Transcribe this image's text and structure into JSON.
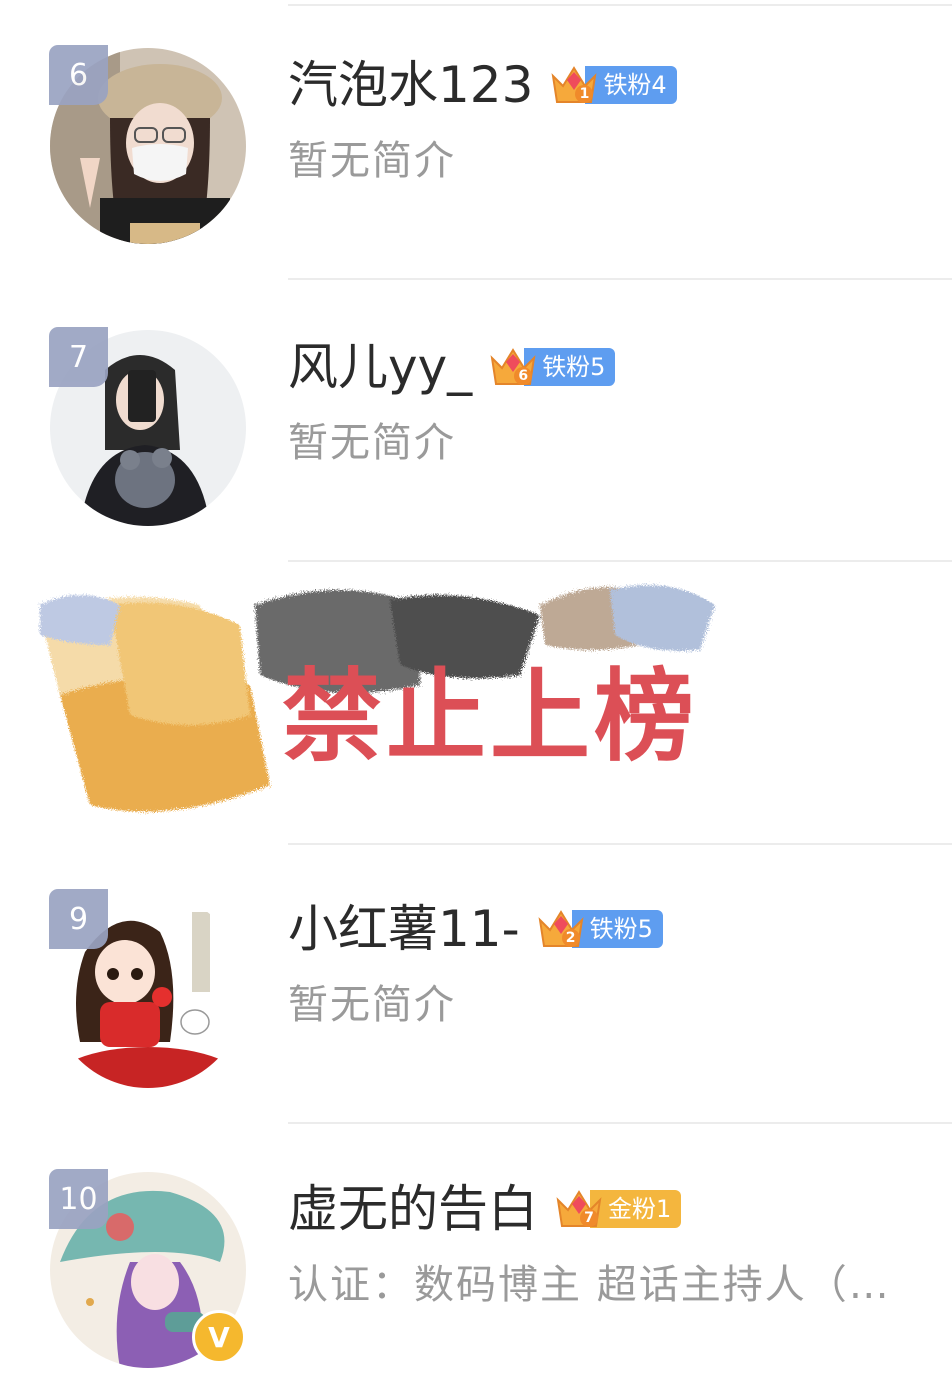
{
  "rows": [
    {
      "rank": "6",
      "name": "汽泡水123",
      "crown_level": "1",
      "badge_label": "铁粉4",
      "badge_type": "iron",
      "bio": "暂无简介"
    },
    {
      "rank": "7",
      "name": "风儿yy_",
      "crown_level": "6",
      "badge_label": "铁粉5",
      "badge_type": "iron",
      "bio": "暂无简介"
    },
    {
      "rank": "9",
      "name": "小红薯11-",
      "crown_level": "2",
      "badge_label": "铁粉5",
      "badge_type": "iron",
      "bio": "暂无简介"
    },
    {
      "rank": "10",
      "name": "虚无的告白",
      "crown_level": "7",
      "badge_label": "金粉1",
      "badge_type": "gold",
      "bio": "认证：数码博主 超话主持人（…"
    }
  ],
  "banned": {
    "text": "禁止上榜"
  },
  "verify_badge": "V",
  "colors": {
    "iron_badge": "#5e9df0",
    "gold_badge": "#f4b63e",
    "rank_tag": "#9aa3c2",
    "banned_text": "#dc4f56"
  },
  "icons": {
    "crown": "crown-icon",
    "verified": "verified-v-icon"
  }
}
